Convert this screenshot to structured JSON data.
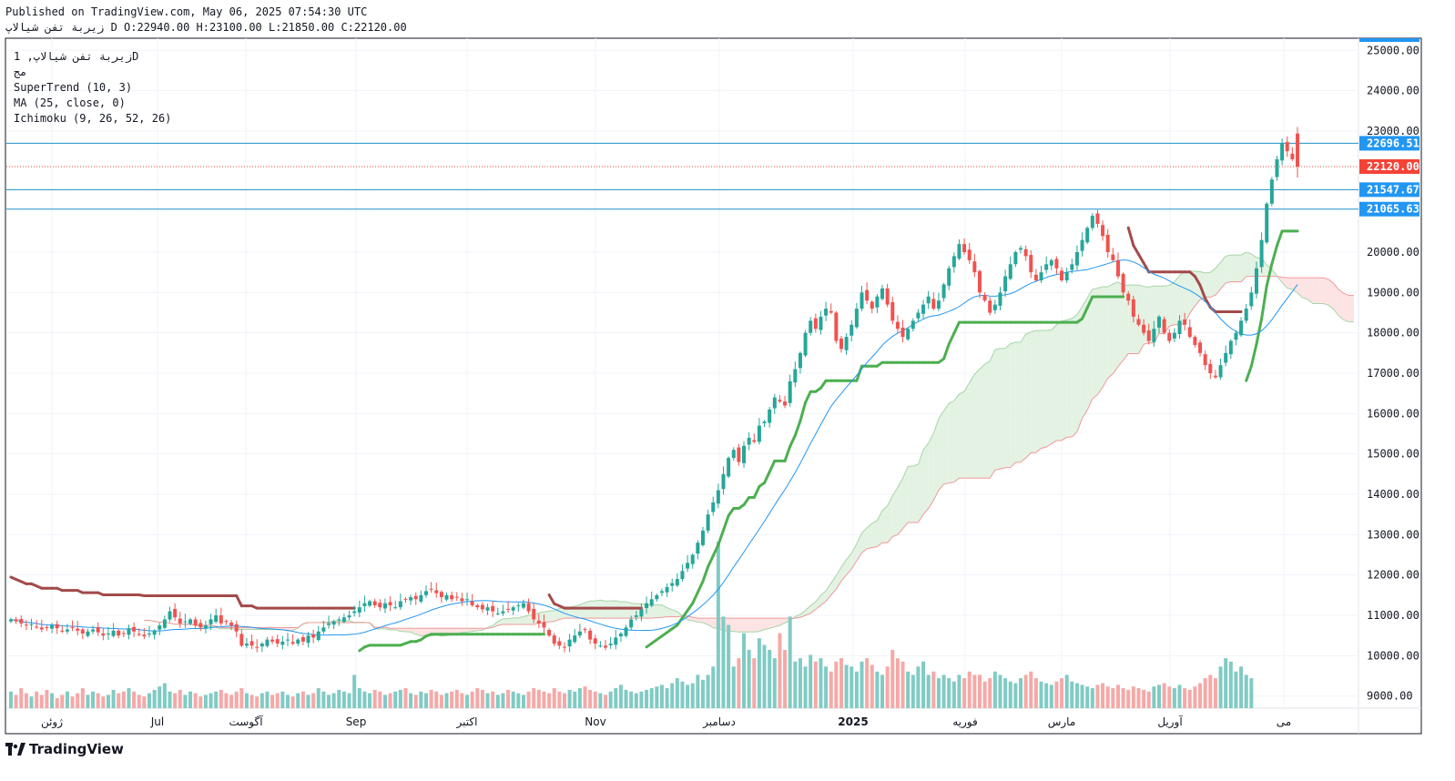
{
  "header": {
    "published_line": "Published on TradingView.com, May 06, 2025 07:54:30 UTC",
    "ohlc_line": "زيربة تفن شيالاپ D O:22940.00 H:23100.00 L:21850.00 C:22120.00"
  },
  "legend": {
    "symbol_line": "زيربة تفن شيالاپ, 1D",
    "exchange": "مج",
    "indicators": [
      "SuperTrend (10, 3)",
      "MA (25, close, 0)",
      "Ichimoku (9, 26, 52, 26)"
    ]
  },
  "brand": {
    "name": "TradingView"
  },
  "colors": {
    "up": "#26a69a",
    "down": "#ef5350",
    "supertrend_up": "#4caf50",
    "supertrend_down": "#a34a4a",
    "ma": "#2196f3",
    "cloud_green": "#e3f2e3",
    "cloud_red": "#fde3e3",
    "hline": "#1f8fc8",
    "price_label": "#f44336"
  },
  "chart_data": {
    "type": "candlestick",
    "y_axis": {
      "min": 8700,
      "max": 25300,
      "side": "right",
      "ticks": [
        {
          "value": 9000,
          "label": "9000.00"
        },
        {
          "value": 10000,
          "label": "10000.00"
        },
        {
          "value": 11000,
          "label": "11000.00"
        },
        {
          "value": 12000,
          "label": "12000.00"
        },
        {
          "value": 13000,
          "label": "13000.00"
        },
        {
          "value": 14000,
          "label": "14000.00"
        },
        {
          "value": 15000,
          "label": "15000.00"
        },
        {
          "value": 16000,
          "label": "16000.00"
        },
        {
          "value": 17000,
          "label": "17000.00"
        },
        {
          "value": 18000,
          "label": "18000.00"
        },
        {
          "value": 19000,
          "label": "19000.00"
        },
        {
          "value": 20000,
          "label": "20000.00"
        },
        {
          "value": 23000,
          "label": "23000.00"
        },
        {
          "value": 24000,
          "label": "24000.00"
        },
        {
          "value": 25000,
          "label": "25000.00"
        }
      ]
    },
    "x_axis": {
      "labels": [
        "ژوئن",
        "Jul",
        "آگوست",
        "Sep",
        "اکتبر",
        "Nov",
        "دسامبر",
        "2025",
        "فوریه",
        "مارس",
        "آوریل",
        "می"
      ]
    },
    "horizontal_lines": [
      {
        "value": 22696.51,
        "label": "22696.51"
      },
      {
        "value": 21547.67,
        "label": "21547.67"
      },
      {
        "value": 21065.63,
        "label": "21065.63"
      }
    ],
    "last_price": {
      "value": 22120.0,
      "label": "22120.00"
    },
    "current_bar": {
      "open": 22940.0,
      "high": 23100.0,
      "low": 21850.0,
      "close": 22120.0
    },
    "closes": [
      10900,
      10850,
      10800,
      10750,
      10780,
      10700,
      10650,
      10700,
      10750,
      10680,
      10600,
      10650,
      10700,
      10620,
      10550,
      10600,
      10650,
      10580,
      10500,
      10550,
      10620,
      10500,
      10550,
      10680,
      10600,
      10520,
      10480,
      10550,
      10620,
      10750,
      10900,
      11100,
      10950,
      10800,
      10850,
      10900,
      10750,
      10700,
      10750,
      10900,
      11000,
      10800,
      10850,
      10750,
      10600,
      10250,
      10300,
      10250,
      10200,
      10300,
      10400,
      10350,
      10300,
      10350,
      10400,
      10300,
      10400,
      10350,
      10500,
      10450,
      10600,
      10700,
      10800,
      10850,
      10900,
      10950,
      11000,
      11100,
      11200,
      11300,
      11350,
      11250,
      11200,
      11300,
      11250,
      11200,
      11350,
      11400,
      11450,
      11400,
      11500,
      11600,
      11650,
      11550,
      11450,
      11500,
      11400,
      11450,
      11350,
      11400,
      11250,
      11200,
      11150,
      11200,
      11100,
      11050,
      11100,
      11150,
      11200,
      11250,
      11300,
      11100,
      10900,
      10800,
      10700,
      10500,
      10300,
      10250,
      10200,
      10400,
      10500,
      10600,
      10650,
      10400,
      10300,
      10250,
      10200,
      10300,
      10450,
      10550,
      10700,
      10900,
      11000,
      11150,
      11300,
      11400,
      11500,
      11600,
      11700,
      11800,
      11900,
      12100,
      12300,
      12500,
      12800,
      13100,
      13500,
      13800,
      14100,
      14500,
      14900,
      15100,
      14800,
      15200,
      15400,
      15300,
      15700,
      15800,
      16100,
      16400,
      16300,
      16200,
      16800,
      17100,
      17500,
      18000,
      18300,
      18100,
      18400,
      18600,
      18500,
      17800,
      17600,
      17900,
      18200,
      18600,
      19000,
      18800,
      18600,
      18900,
      19100,
      18700,
      18300,
      18100,
      17900,
      18100,
      18300,
      18500,
      18700,
      18900,
      18600,
      18800,
      19200,
      19600,
      19900,
      20200,
      20000,
      19800,
      19500,
      19000,
      18800,
      18500,
      18700,
      19000,
      19400,
      19700,
      20000,
      20100,
      19900,
      19500,
      19300,
      19500,
      19700,
      19800,
      19600,
      19300,
      19500,
      19700,
      20000,
      20300,
      20600,
      20900,
      20700,
      20400,
      20000,
      19800,
      19400,
      19000,
      18800,
      18400,
      18200,
      18000,
      17800,
      18100,
      18400,
      18000,
      17800,
      18000,
      18300,
      18200,
      17900,
      17700,
      17500,
      17200,
      17000,
      16900,
      17200,
      17500,
      17800,
      18000,
      18300,
      18600,
      19000,
      19600,
      20300,
      21200,
      21800,
      22300,
      22700,
      22500,
      22300,
      22120
    ],
    "volumes_relative": [
      0.1,
      0.08,
      0.12,
      0.09,
      0.07,
      0.1,
      0.08,
      0.11,
      0.09,
      0.06,
      0.08,
      0.1,
      0.07,
      0.09,
      0.12,
      0.08,
      0.1,
      0.09,
      0.07,
      0.08,
      0.11,
      0.09,
      0.1,
      0.12,
      0.1,
      0.08,
      0.07,
      0.09,
      0.11,
      0.13,
      0.15,
      0.1,
      0.09,
      0.11,
      0.08,
      0.1,
      0.09,
      0.07,
      0.08,
      0.09,
      0.1,
      0.11,
      0.09,
      0.08,
      0.1,
      0.12,
      0.09,
      0.08,
      0.07,
      0.09,
      0.1,
      0.08,
      0.09,
      0.1,
      0.08,
      0.07,
      0.09,
      0.1,
      0.08,
      0.09,
      0.12,
      0.1,
      0.08,
      0.09,
      0.11,
      0.1,
      0.09,
      0.2,
      0.12,
      0.1,
      0.09,
      0.11,
      0.1,
      0.08,
      0.09,
      0.1,
      0.11,
      0.12,
      0.09,
      0.08,
      0.1,
      0.09,
      0.11,
      0.1,
      0.08,
      0.09,
      0.1,
      0.11,
      0.09,
      0.08,
      0.1,
      0.12,
      0.11,
      0.09,
      0.1,
      0.08,
      0.09,
      0.11,
      0.1,
      0.09,
      0.08,
      0.1,
      0.12,
      0.11,
      0.1,
      0.09,
      0.12,
      0.1,
      0.09,
      0.11,
      0.1,
      0.12,
      0.13,
      0.11,
      0.1,
      0.09,
      0.08,
      0.1,
      0.12,
      0.14,
      0.11,
      0.1,
      0.09,
      0.1,
      0.11,
      0.12,
      0.13,
      0.14,
      0.12,
      0.15,
      0.18,
      0.16,
      0.14,
      0.15,
      0.2,
      0.17,
      0.2,
      0.25,
      1.0,
      0.55,
      0.5,
      0.25,
      0.3,
      0.45,
      0.35,
      0.3,
      0.42,
      0.38,
      0.35,
      0.3,
      0.45,
      0.35,
      0.55,
      0.28,
      0.3,
      0.25,
      0.32,
      0.28,
      0.3,
      0.25,
      0.22,
      0.28,
      0.3,
      0.26,
      0.25,
      0.22,
      0.28,
      0.3,
      0.26,
      0.22,
      0.2,
      0.25,
      0.35,
      0.3,
      0.28,
      0.22,
      0.2,
      0.25,
      0.28,
      0.2,
      0.22,
      0.18,
      0.2,
      0.18,
      0.16,
      0.2,
      0.18,
      0.22,
      0.2,
      0.2,
      0.16,
      0.18,
      0.22,
      0.2,
      0.18,
      0.16,
      0.15,
      0.18,
      0.2,
      0.22,
      0.18,
      0.16,
      0.15,
      0.14,
      0.16,
      0.18,
      0.2,
      0.16,
      0.15,
      0.14,
      0.13,
      0.12,
      0.14,
      0.15,
      0.13,
      0.12,
      0.14,
      0.12,
      0.11,
      0.13,
      0.12,
      0.11,
      0.1,
      0.13,
      0.14,
      0.15,
      0.13,
      0.12,
      0.14,
      0.12,
      0.11,
      0.13,
      0.15,
      0.18,
      0.2,
      0.18,
      0.25,
      0.3,
      0.28,
      0.22,
      0.25,
      0.2,
      0.18
    ]
  }
}
